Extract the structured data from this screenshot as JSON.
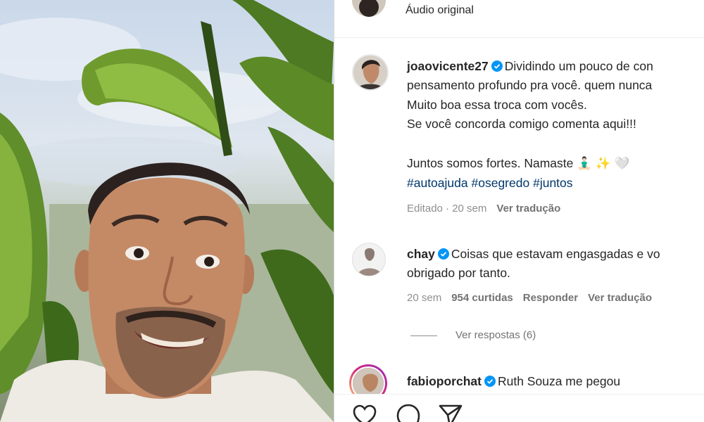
{
  "post": {
    "audio_label": "Áudio original",
    "author": "joaovicente27",
    "caption_lines": [
      "Dividindo um pouco de con",
      "pensamento profundo pra você. quem nunca",
      "Muito boa essa troca com vocês.",
      "Se você concorda comigo comenta aqui!!!",
      "Juntos somos fortes. Namaste 🧘🏻‍♂️ ✨ 🤍"
    ],
    "hashtags": [
      "#autoajuda",
      "#osegredo",
      "#juntos"
    ],
    "meta": {
      "edited": "Editado · 20 sem",
      "translate": "Ver tradução"
    }
  },
  "comments": [
    {
      "username": "chay",
      "lines": [
        "Coisas que estavam engasgadas e vo",
        "obrigado por tanto."
      ],
      "age": "20 sem",
      "likes": "954 curtidas",
      "reply": "Responder",
      "translate": "Ver tradução",
      "view_replies": "Ver respostas (6)"
    },
    {
      "username": "fabioporchat",
      "lines": [
        "Ruth Souza me pegou"
      ]
    }
  ],
  "icons": {
    "verified": "verified-badge-icon",
    "like": "heart-icon",
    "comment": "comment-icon",
    "share": "send-icon"
  },
  "colors": {
    "verified": "#0095f6",
    "hashtag": "#00376b",
    "meta": "#8e8e8e"
  }
}
